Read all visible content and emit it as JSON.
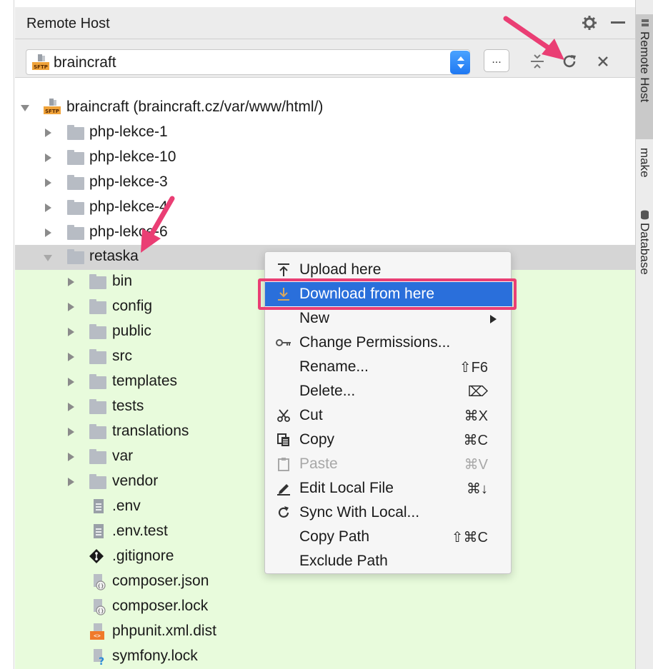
{
  "panel": {
    "title": "Remote Host"
  },
  "toolbar": {
    "server_selected": "braincraft",
    "browse_label": "..."
  },
  "tree": {
    "root": {
      "label": "braincraft (braincraft.cz/var/www/html/)"
    },
    "items": [
      {
        "label": "php-lekce-1"
      },
      {
        "label": "php-lekce-10"
      },
      {
        "label": "php-lekce-3"
      },
      {
        "label": "php-lekce-4"
      },
      {
        "label": "php-lekce-6"
      },
      {
        "label": "retaska"
      }
    ],
    "children": [
      {
        "label": "bin"
      },
      {
        "label": "config"
      },
      {
        "label": "public"
      },
      {
        "label": "src"
      },
      {
        "label": "templates"
      },
      {
        "label": "tests"
      },
      {
        "label": "translations"
      },
      {
        "label": "var"
      },
      {
        "label": "vendor"
      }
    ],
    "files": [
      {
        "label": ".env",
        "icon": "text-file-icon"
      },
      {
        "label": ".env.test",
        "icon": "text-file-icon"
      },
      {
        "label": ".gitignore",
        "icon": "git-icon"
      },
      {
        "label": "composer.json",
        "icon": "composer-file-icon"
      },
      {
        "label": "composer.lock",
        "icon": "composer-file-icon"
      },
      {
        "label": "phpunit.xml.dist",
        "icon": "xml-file-icon"
      },
      {
        "label": "symfony.lock",
        "icon": "unknown-file-icon"
      }
    ]
  },
  "context_menu": {
    "items": [
      {
        "label": "Upload here",
        "shortcut": "",
        "icon": "upload-icon"
      },
      {
        "label": "Download from here",
        "shortcut": "",
        "icon": "download-icon",
        "highlighted": true
      },
      {
        "label": "New",
        "shortcut": "",
        "icon": "",
        "submenu": true
      },
      {
        "label": "Change Permissions...",
        "shortcut": "",
        "icon": "key-icon"
      },
      {
        "label": "Rename...",
        "shortcut": "⇧F6",
        "icon": ""
      },
      {
        "label": "Delete...",
        "shortcut": "⌦",
        "icon": ""
      },
      {
        "label": "Cut",
        "shortcut": "⌘X",
        "icon": "scissors-icon"
      },
      {
        "label": "Copy",
        "shortcut": "⌘C",
        "icon": "copy-icon"
      },
      {
        "label": "Paste",
        "shortcut": "⌘V",
        "icon": "paste-icon",
        "disabled": true
      },
      {
        "label": "Edit Local File",
        "shortcut": "⌘↓",
        "icon": "pencil-icon"
      },
      {
        "label": "Sync With Local...",
        "shortcut": "",
        "icon": "sync-icon"
      },
      {
        "label": "Copy Path",
        "shortcut": "⇧⌘C",
        "icon": ""
      },
      {
        "label": "Exclude Path",
        "shortcut": "",
        "icon": ""
      }
    ]
  },
  "right_sidebar": {
    "tabs": [
      {
        "label": "Remote Host",
        "active": true
      },
      {
        "label": "make"
      },
      {
        "label": "Database"
      }
    ]
  },
  "colors": {
    "highlight": "#2a6fdb",
    "annotation": "#ea3e74",
    "uploaded_area": "#e8fbdc"
  }
}
